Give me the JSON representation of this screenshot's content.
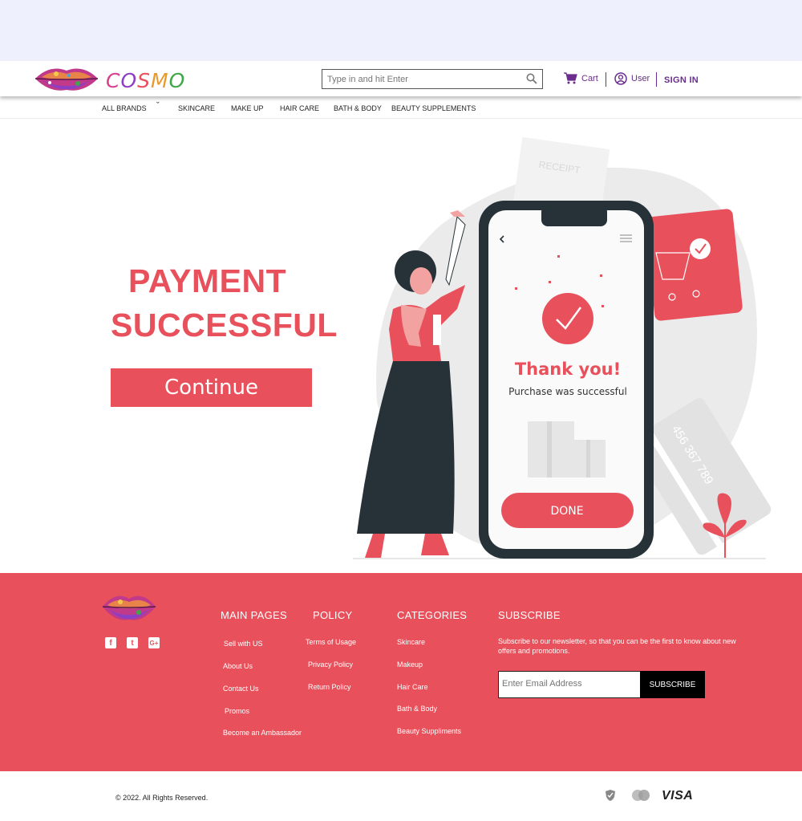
{
  "brand": {
    "name": "COSMO",
    "letter_colors": [
      "#d93f8e",
      "#8c3fc4",
      "#e8505b",
      "#e89a2b",
      "#3fa64a"
    ]
  },
  "header": {
    "search_placeholder": "Type in and hit Enter",
    "cart_label": "Cart",
    "user_label": "User",
    "signin_label": "SIGN IN"
  },
  "nav": {
    "items": [
      "ALL BRANDS",
      "SKINCARE",
      "MAKE UP",
      "HAIR CARE",
      "BATH & BODY",
      "BEAUTY SUPPLEMENTS"
    ]
  },
  "main": {
    "title_line1": "PAYMENT",
    "title_line2": "SUCCESSFUL",
    "continue_label": "Continue"
  },
  "illustration": {
    "receipt_label": "RECEIPT",
    "thank_you": "Thank you!",
    "purchase_text": "Purchase was successful",
    "done_label": "DONE",
    "card_number": "456 367 789"
  },
  "footer": {
    "main_pages": {
      "heading": "MAIN PAGES",
      "links": [
        "Sell with US",
        "About Us",
        "Contact Us",
        "Promos",
        "Become an Ambassador"
      ]
    },
    "policy": {
      "heading": "POLICY",
      "links": [
        "Terms of Usage",
        "Privacy Policy",
        "Return Policy"
      ]
    },
    "categories": {
      "heading": "CATEGORIES",
      "links": [
        "Skincare",
        "Makeup",
        "Hair Care",
        "Bath & Body",
        "Beauty Suppliments"
      ]
    },
    "subscribe": {
      "heading": "SUBSCRIBE",
      "text": "Subscribe to our newsletter, so that you can be the first to know about new offers and promotions.",
      "email_placeholder": "Enter Email Address",
      "button_label": "SUBSCRIBE"
    },
    "social": [
      "facebook-icon",
      "twitter-icon",
      "google-plus-icon"
    ]
  },
  "bottom": {
    "copyright": "© 2022. All Rights Reserved.",
    "visa_label": "VISA"
  },
  "colors": {
    "accent": "#e8505b",
    "purple": "#6a2c8f",
    "top_band": "#eef0fd",
    "phone_dark": "#263238"
  }
}
